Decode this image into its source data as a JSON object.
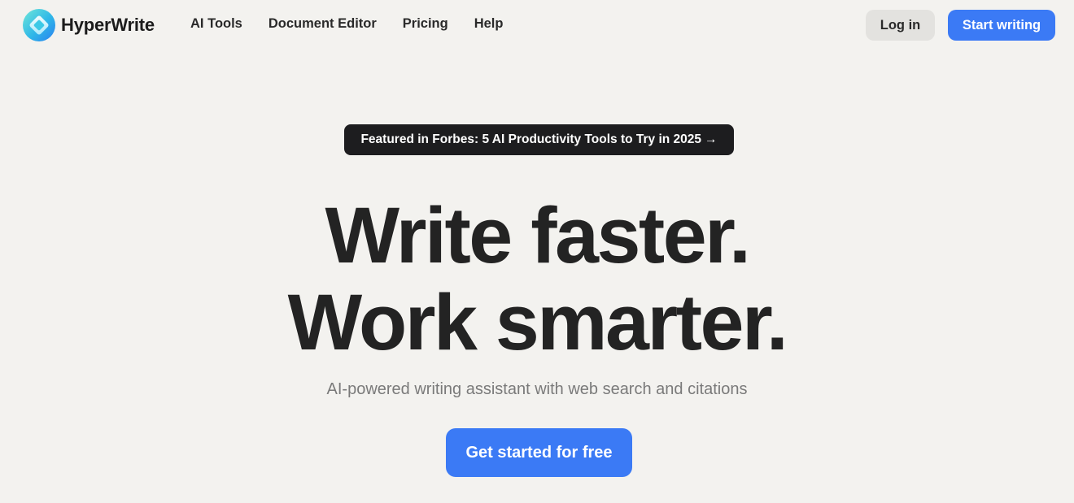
{
  "header": {
    "brand": "HyperWrite",
    "nav": [
      {
        "label": "AI Tools"
      },
      {
        "label": "Document Editor"
      },
      {
        "label": "Pricing"
      },
      {
        "label": "Help"
      }
    ],
    "login_label": "Log in",
    "start_label": "Start writing"
  },
  "hero": {
    "badge": "Featured in Forbes: 5 AI Productivity Tools to Try in 2025",
    "badge_arrow": "→",
    "headline_line1": "Write faster.",
    "headline_line2": "Work smarter.",
    "subtitle": "AI-powered writing assistant with web search and citations",
    "cta_label": "Get started for free"
  },
  "colors": {
    "background": "#f3f2ef",
    "accent": "#3b7af5",
    "badge_bg": "#1d1d1f",
    "login_bg": "#e3e2df"
  },
  "icons": {
    "logo": "hyperwrite-logo-icon",
    "arrow": "arrow-right-icon"
  }
}
